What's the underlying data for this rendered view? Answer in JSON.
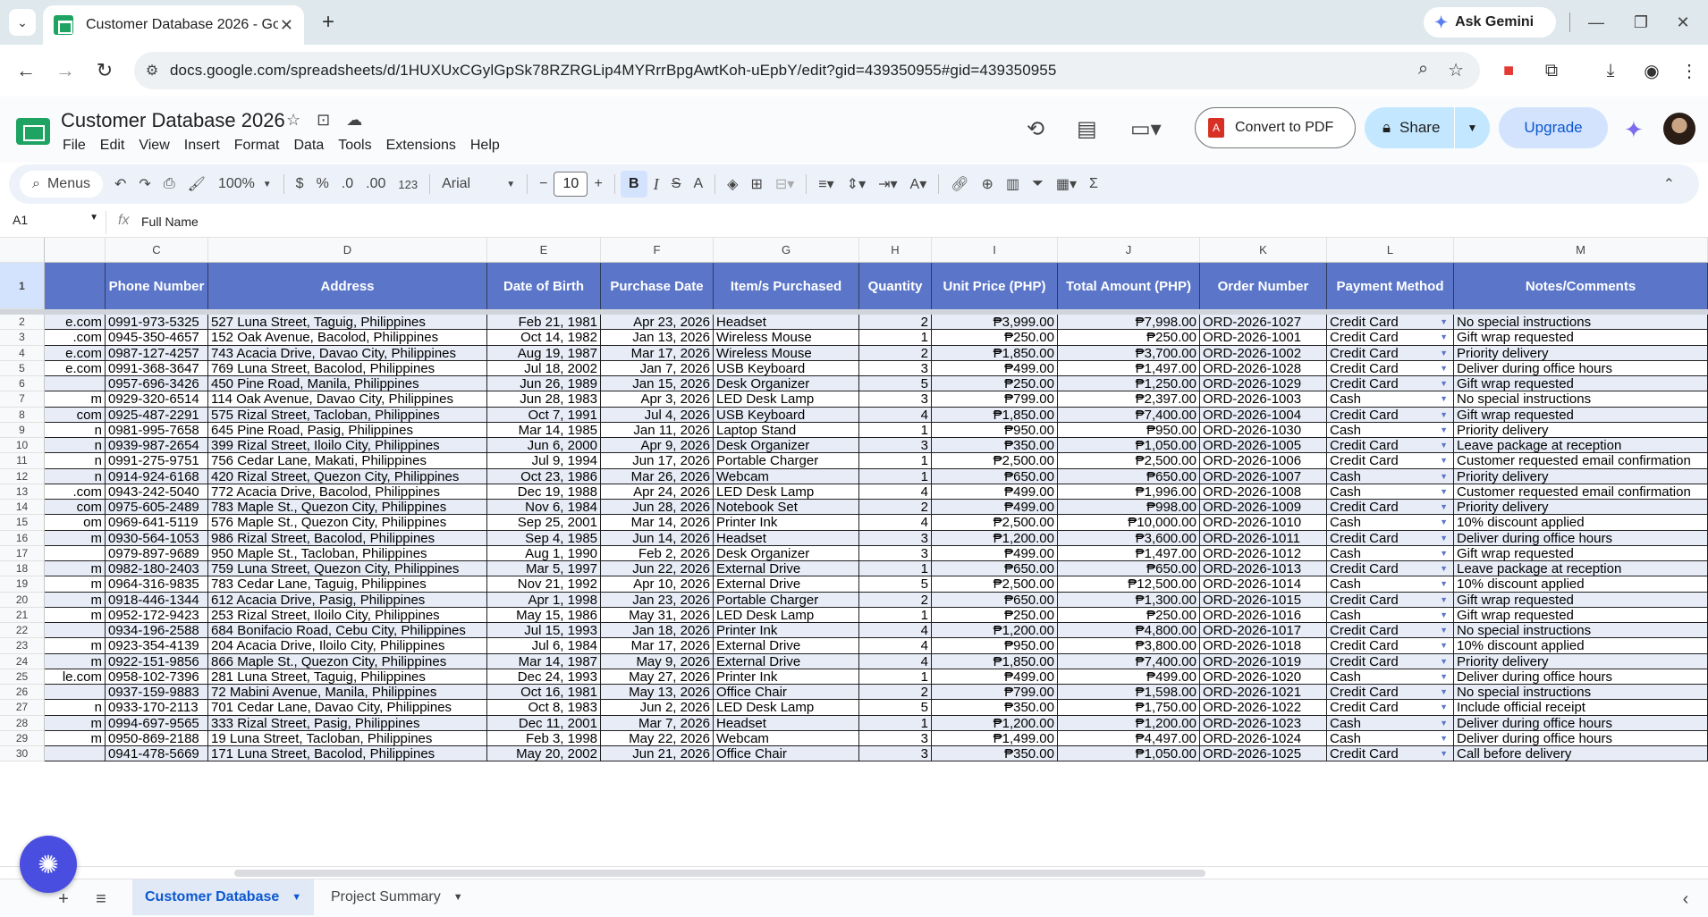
{
  "browser": {
    "tab_title": "Customer Database 2026 - Goo",
    "url": "docs.google.com/spreadsheets/d/1HUXUxCGylGpSk78RZRGLip4MYRrrBpgAwtKoh-uEpbY/edit?gid=439350955#gid=439350955",
    "gemini_label": "Ask Gemini"
  },
  "doc": {
    "title": "Customer Database 2026",
    "menus": [
      "File",
      "Edit",
      "View",
      "Insert",
      "Format",
      "Data",
      "Tools",
      "Extensions",
      "Help"
    ],
    "convert_pdf": "Convert to PDF",
    "share": "Share",
    "upgrade": "Upgrade"
  },
  "toolbar": {
    "menus_label": "Menus",
    "zoom": "100%",
    "currency": "$",
    "percent": "%",
    "dec_decrease": ".0",
    "dec_increase": ".00",
    "number_format": "123",
    "font": "Arial",
    "font_size": "10"
  },
  "formula_bar": {
    "cell_ref": "A1",
    "fx": "fx",
    "value": "Full Name"
  },
  "sheet": {
    "column_letters": [
      "C",
      "D",
      "E",
      "F",
      "G",
      "H",
      "I",
      "J",
      "K",
      "L",
      "M"
    ],
    "headers": [
      "Phone Number",
      "Address",
      "Date of Birth",
      "Purchase Date",
      "Item/s Purchased",
      "Quantity",
      "Unit Price (PHP)",
      "Total Amount (PHP)",
      "Order Number",
      "Payment Method",
      "Notes/Comments"
    ],
    "header_row_num": "1",
    "rows": [
      {
        "n": "2",
        "b": "e.com",
        "c": [
          "0991-973-5325",
          "527 Luna Street, Taguig, Philippines",
          "Feb 21, 1981",
          "Apr 23, 2026",
          "Headset",
          "2",
          "₱3,999.00",
          "₱7,998.00",
          "ORD-2026-1027",
          "Credit Card",
          "No special instructions"
        ]
      },
      {
        "n": "3",
        "b": ".com",
        "c": [
          "0945-350-4657",
          "152 Oak Avenue, Bacolod, Philippines",
          "Oct 14, 1982",
          "Jan 13, 2026",
          "Wireless Mouse",
          "1",
          "₱250.00",
          "₱250.00",
          "ORD-2026-1001",
          "Credit Card",
          "Gift wrap requested"
        ]
      },
      {
        "n": "4",
        "b": "e.com",
        "c": [
          "0987-127-4257",
          "743 Acacia Drive, Davao City, Philippines",
          "Aug 19, 1987",
          "Mar 17, 2026",
          "Wireless Mouse",
          "2",
          "₱1,850.00",
          "₱3,700.00",
          "ORD-2026-1002",
          "Credit Card",
          "Priority delivery"
        ]
      },
      {
        "n": "5",
        "b": "e.com",
        "c": [
          "0991-368-3647",
          "769 Luna Street, Bacolod, Philippines",
          "Jul 18, 2002",
          "Jan 7, 2026",
          "USB Keyboard",
          "3",
          "₱499.00",
          "₱1,497.00",
          "ORD-2026-1028",
          "Credit Card",
          "Deliver during office hours"
        ]
      },
      {
        "n": "6",
        "b": "",
        "c": [
          "0957-696-3426",
          "450 Pine Road, Manila, Philippines",
          "Jun 26, 1989",
          "Jan 15, 2026",
          "Desk Organizer",
          "5",
          "₱250.00",
          "₱1,250.00",
          "ORD-2026-1029",
          "Credit Card",
          "Gift wrap requested"
        ]
      },
      {
        "n": "7",
        "b": "m",
        "c": [
          "0929-320-6514",
          "114 Oak Avenue, Davao City, Philippines",
          "Jun 28, 1983",
          "Apr 3, 2026",
          "LED Desk Lamp",
          "3",
          "₱799.00",
          "₱2,397.00",
          "ORD-2026-1003",
          "Cash",
          "No special instructions"
        ]
      },
      {
        "n": "8",
        "b": "com",
        "c": [
          "0925-487-2291",
          "575 Rizal Street, Tacloban, Philippines",
          "Oct 7, 1991",
          "Jul 4, 2026",
          "USB Keyboard",
          "4",
          "₱1,850.00",
          "₱7,400.00",
          "ORD-2026-1004",
          "Credit Card",
          "Gift wrap requested"
        ]
      },
      {
        "n": "9",
        "b": "n",
        "c": [
          "0981-995-7658",
          "645 Pine Road, Pasig, Philippines",
          "Mar 14, 1985",
          "Jan 11, 2026",
          "Laptop Stand",
          "1",
          "₱950.00",
          "₱950.00",
          "ORD-2026-1030",
          "Cash",
          "Priority delivery"
        ]
      },
      {
        "n": "10",
        "b": "n",
        "c": [
          "0939-987-2654",
          "399 Rizal Street, Iloilo City, Philippines",
          "Jun 6, 2000",
          "Apr 9, 2026",
          "Desk Organizer",
          "3",
          "₱350.00",
          "₱1,050.00",
          "ORD-2026-1005",
          "Credit Card",
          "Leave package at reception"
        ]
      },
      {
        "n": "11",
        "b": "n",
        "c": [
          "0991-275-9751",
          "756 Cedar Lane, Makati, Philippines",
          "Jul 9, 1994",
          "Jun 17, 2026",
          "Portable Charger",
          "1",
          "₱2,500.00",
          "₱2,500.00",
          "ORD-2026-1006",
          "Credit Card",
          "Customer requested email confirmation"
        ]
      },
      {
        "n": "12",
        "b": "n",
        "c": [
          "0914-924-6168",
          "420 Rizal Street, Quezon City, Philippines",
          "Oct 23, 1986",
          "Mar 26, 2026",
          "Webcam",
          "1",
          "₱650.00",
          "₱650.00",
          "ORD-2026-1007",
          "Cash",
          "Priority delivery"
        ]
      },
      {
        "n": "13",
        "b": ".com",
        "c": [
          "0943-242-5040",
          "772 Acacia Drive, Bacolod, Philippines",
          "Dec 19, 1988",
          "Apr 24, 2026",
          "LED Desk Lamp",
          "4",
          "₱499.00",
          "₱1,996.00",
          "ORD-2026-1008",
          "Cash",
          "Customer requested email confirmation"
        ]
      },
      {
        "n": "14",
        "b": "com",
        "c": [
          "0975-605-2489",
          "783 Maple St., Quezon City, Philippines",
          "Nov 6, 1984",
          "Jun 28, 2026",
          "Notebook Set",
          "2",
          "₱499.00",
          "₱998.00",
          "ORD-2026-1009",
          "Credit Card",
          "Priority delivery"
        ]
      },
      {
        "n": "15",
        "b": "om",
        "c": [
          "0969-641-5119",
          "576 Maple St., Quezon City, Philippines",
          "Sep 25, 2001",
          "Mar 14, 2026",
          "Printer Ink",
          "4",
          "₱2,500.00",
          "₱10,000.00",
          "ORD-2026-1010",
          "Cash",
          "10% discount applied"
        ]
      },
      {
        "n": "16",
        "b": "m",
        "c": [
          "0930-564-1053",
          "986 Rizal Street, Bacolod, Philippines",
          "Sep 4, 1985",
          "Jun 14, 2026",
          "Headset",
          "3",
          "₱1,200.00",
          "₱3,600.00",
          "ORD-2026-1011",
          "Credit Card",
          "Deliver during office hours"
        ]
      },
      {
        "n": "17",
        "b": "",
        "c": [
          "0979-897-9689",
          "950 Maple St., Tacloban, Philippines",
          "Aug 1, 1990",
          "Feb 2, 2026",
          "Desk Organizer",
          "3",
          "₱499.00",
          "₱1,497.00",
          "ORD-2026-1012",
          "Cash",
          "Gift wrap requested"
        ]
      },
      {
        "n": "18",
        "b": "m",
        "c": [
          "0982-180-2403",
          "759 Luna Street, Quezon City, Philippines",
          "Mar 5, 1997",
          "Jun 22, 2026",
          "External Drive",
          "1",
          "₱650.00",
          "₱650.00",
          "ORD-2026-1013",
          "Credit Card",
          "Leave package at reception"
        ]
      },
      {
        "n": "19",
        "b": "m",
        "c": [
          "0964-316-9835",
          "783 Cedar Lane, Taguig, Philippines",
          "Nov 21, 1992",
          "Apr 10, 2026",
          "External Drive",
          "5",
          "₱2,500.00",
          "₱12,500.00",
          "ORD-2026-1014",
          "Cash",
          "10% discount applied"
        ]
      },
      {
        "n": "20",
        "b": "m",
        "c": [
          "0918-446-1344",
          "612 Acacia Drive, Pasig, Philippines",
          "Apr 1, 1998",
          "Jan 23, 2026",
          "Portable Charger",
          "2",
          "₱650.00",
          "₱1,300.00",
          "ORD-2026-1015",
          "Credit Card",
          "Gift wrap requested"
        ]
      },
      {
        "n": "21",
        "b": "m",
        "c": [
          "0952-172-9423",
          "253 Rizal Street, Iloilo City, Philippines",
          "May 15, 1986",
          "May 31, 2026",
          "LED Desk Lamp",
          "1",
          "₱250.00",
          "₱250.00",
          "ORD-2026-1016",
          "Cash",
          "Gift wrap requested"
        ]
      },
      {
        "n": "22",
        "b": "",
        "c": [
          "0934-196-2588",
          "684 Bonifacio Road, Cebu City, Philippines",
          "Jul 15, 1993",
          "Jan 18, 2026",
          "Printer Ink",
          "4",
          "₱1,200.00",
          "₱4,800.00",
          "ORD-2026-1017",
          "Credit Card",
          "No special instructions"
        ]
      },
      {
        "n": "23",
        "b": "m",
        "c": [
          "0923-354-4139",
          "204 Acacia Drive, Iloilo City, Philippines",
          "Jul 6, 1984",
          "Mar 17, 2026",
          "External Drive",
          "4",
          "₱950.00",
          "₱3,800.00",
          "ORD-2026-1018",
          "Credit Card",
          "10% discount applied"
        ]
      },
      {
        "n": "24",
        "b": "m",
        "c": [
          "0922-151-9856",
          "866 Maple St., Quezon City, Philippines",
          "Mar 14, 1987",
          "May 9, 2026",
          "External Drive",
          "4",
          "₱1,850.00",
          "₱7,400.00",
          "ORD-2026-1019",
          "Credit Card",
          "Priority delivery"
        ]
      },
      {
        "n": "25",
        "b": "le.com",
        "c": [
          "0958-102-7396",
          "281 Luna Street, Taguig, Philippines",
          "Dec 24, 1993",
          "May 27, 2026",
          "Printer Ink",
          "1",
          "₱499.00",
          "₱499.00",
          "ORD-2026-1020",
          "Cash",
          "Deliver during office hours"
        ]
      },
      {
        "n": "26",
        "b": "",
        "c": [
          "0937-159-9883",
          "72 Mabini Avenue, Manila, Philippines",
          "Oct 16, 1981",
          "May 13, 2026",
          "Office Chair",
          "2",
          "₱799.00",
          "₱1,598.00",
          "ORD-2026-1021",
          "Credit Card",
          "No special instructions"
        ]
      },
      {
        "n": "27",
        "b": "n",
        "c": [
          "0933-170-2113",
          "701 Cedar Lane, Davao City, Philippines",
          "Oct 8, 1983",
          "Jun 2, 2026",
          "LED Desk Lamp",
          "5",
          "₱350.00",
          "₱1,750.00",
          "ORD-2026-1022",
          "Credit Card",
          "Include official receipt"
        ]
      },
      {
        "n": "28",
        "b": "m",
        "c": [
          "0994-697-9565",
          "333 Rizal Street, Pasig, Philippines",
          "Dec 11, 2001",
          "Mar 7, 2026",
          "Headset",
          "1",
          "₱1,200.00",
          "₱1,200.00",
          "ORD-2026-1023",
          "Cash",
          "Deliver during office hours"
        ]
      },
      {
        "n": "29",
        "b": "m",
        "c": [
          "0950-869-2188",
          "19 Luna Street, Tacloban, Philippines",
          "Feb 3, 1998",
          "May 22, 2026",
          "Webcam",
          "3",
          "₱1,499.00",
          "₱4,497.00",
          "ORD-2026-1024",
          "Cash",
          "Deliver during office hours"
        ]
      },
      {
        "n": "30",
        "b": "",
        "c": [
          "0941-478-5669",
          "171 Luna Street, Bacolod, Philippines",
          "May 20, 2002",
          "Jun 21, 2026",
          "Office Chair",
          "3",
          "₱350.00",
          "₱1,050.00",
          "ORD-2026-1025",
          "Credit Card",
          "Call before delivery"
        ]
      }
    ]
  },
  "sheet_tabs": [
    {
      "label": "Customer Database",
      "active": true
    },
    {
      "label": "Project Summary",
      "active": false
    }
  ]
}
